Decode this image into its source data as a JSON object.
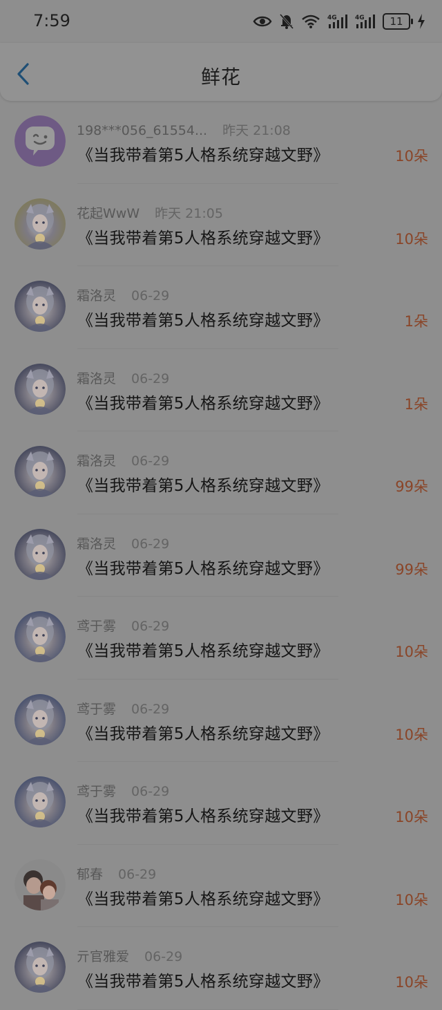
{
  "status_bar": {
    "time": "7:59",
    "battery": "11",
    "icons": [
      "eye-icon",
      "mute-bell-icon",
      "wifi-icon",
      "signal-4g-icon",
      "signal-4g-icon",
      "battery-icon",
      "charging-bolt-icon"
    ]
  },
  "header": {
    "title": "鲜花",
    "back_icon": "chevron-left-icon"
  },
  "colors": {
    "amount": "#8a4528",
    "back": "#1f4f75",
    "background": "#8e8e8e"
  },
  "items": [
    {
      "name": "198***056_61554...",
      "date": "昨天 21:08",
      "book": "《当我带着第5人格系统穿越文野》",
      "amount": "10朵",
      "avatar": "purple-chat-bubble-avatar"
    },
    {
      "name": "花起WwW",
      "date": "昨天 21:05",
      "book": "《当我带着第5人格系统穿越文野》",
      "amount": "10朵",
      "avatar": "anime-girl-avatar"
    },
    {
      "name": "霜洛灵",
      "date": "06-29",
      "book": "《当我带着第5人格系统穿越文野》",
      "amount": "1朵",
      "avatar": "anime-girl-avatar"
    },
    {
      "name": "霜洛灵",
      "date": "06-29",
      "book": "《当我带着第5人格系统穿越文野》",
      "amount": "1朵",
      "avatar": "anime-girl-avatar"
    },
    {
      "name": "霜洛灵",
      "date": "06-29",
      "book": "《当我带着第5人格系统穿越文野》",
      "amount": "99朵",
      "avatar": "anime-girl-avatar"
    },
    {
      "name": "霜洛灵",
      "date": "06-29",
      "book": "《当我带着第5人格系统穿越文野》",
      "amount": "99朵",
      "avatar": "anime-girl-avatar"
    },
    {
      "name": "鸢于雾",
      "date": "06-29",
      "book": "《当我带着第5人格系统穿越文野》",
      "amount": "10朵",
      "avatar": "anime-girl-avatar"
    },
    {
      "name": "鸢于雾",
      "date": "06-29",
      "book": "《当我带着第5人格系统穿越文野》",
      "amount": "10朵",
      "avatar": "anime-girl-avatar"
    },
    {
      "name": "鸢于雾",
      "date": "06-29",
      "book": "《当我带着第5人格系统穿越文野》",
      "amount": "10朵",
      "avatar": "anime-girl-avatar"
    },
    {
      "name": "郁春",
      "date": "06-29",
      "book": "《当我带着第5人格系统穿越文野》",
      "amount": "10朵",
      "avatar": "anime-couple-avatar"
    },
    {
      "name": "亓官雅爱",
      "date": "06-29",
      "book": "《当我带着第5人格系统穿越文野》",
      "amount": "10朵",
      "avatar": "anime-girl-avatar"
    }
  ]
}
